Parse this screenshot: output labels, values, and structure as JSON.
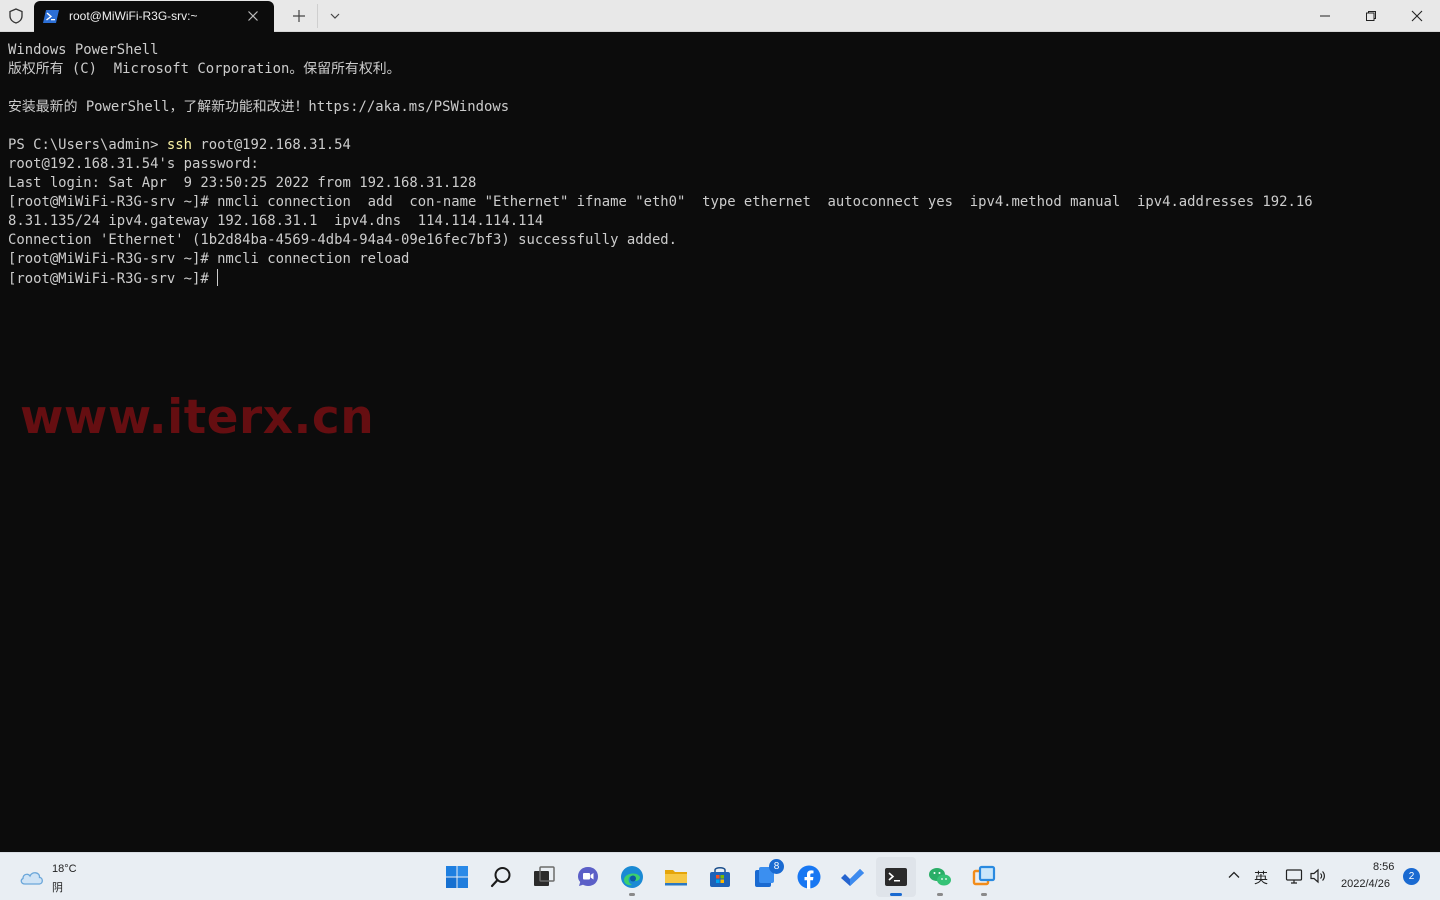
{
  "window": {
    "tab_title": "root@MiWiFi-R3G-srv:~"
  },
  "terminal": {
    "lines": [
      "Windows PowerShell",
      "版权所有 (C)  Microsoft Corporation。保留所有权利。",
      "",
      "安装最新的 PowerShell，了解新功能和改进！https://aka.ms/PSWindows",
      "",
      "",
      "root@192.168.31.54's password:",
      "Last login: Sat Apr  9 23:50:25 2022 from 192.168.31.128",
      "[root@MiWiFi-R3G-srv ~]# nmcli connection  add  con-name \"Ethernet\" ifname \"eth0\"  type ethernet  autoconnect yes  ipv4.method manual  ipv4.addresses 192.16",
      "8.31.135/24 ipv4.gateway 192.168.31.1  ipv4.dns  114.114.114.114",
      "Connection 'Ethernet' (1b2d84ba-4569-4db4-94a4-09e16fec7bf3) successfully added.",
      "[root@MiWiFi-R3G-srv ~]# nmcli connection reload"
    ],
    "ps_prompt": "PS C:\\Users\\admin> ",
    "ps_command": "ssh",
    "ps_args": " root@192.168.31.54",
    "current_prompt": "[root@MiWiFi-R3G-srv ~]# ",
    "watermark": "www.iterx.cn"
  },
  "taskbar": {
    "weather_temp": "18°C",
    "weather_condition": "阴",
    "store_badge": "8",
    "ime_indicator": "英",
    "clock_time": "8:56",
    "clock_date": "2022/4/26",
    "notification_count": "2"
  },
  "colors": {
    "terminal_bg": "#0c0c0c",
    "terminal_fg": "#cccccc",
    "command_highlight": "#f9f1a5",
    "watermark": "#6a0f12",
    "accent": "#1a6ad1"
  }
}
